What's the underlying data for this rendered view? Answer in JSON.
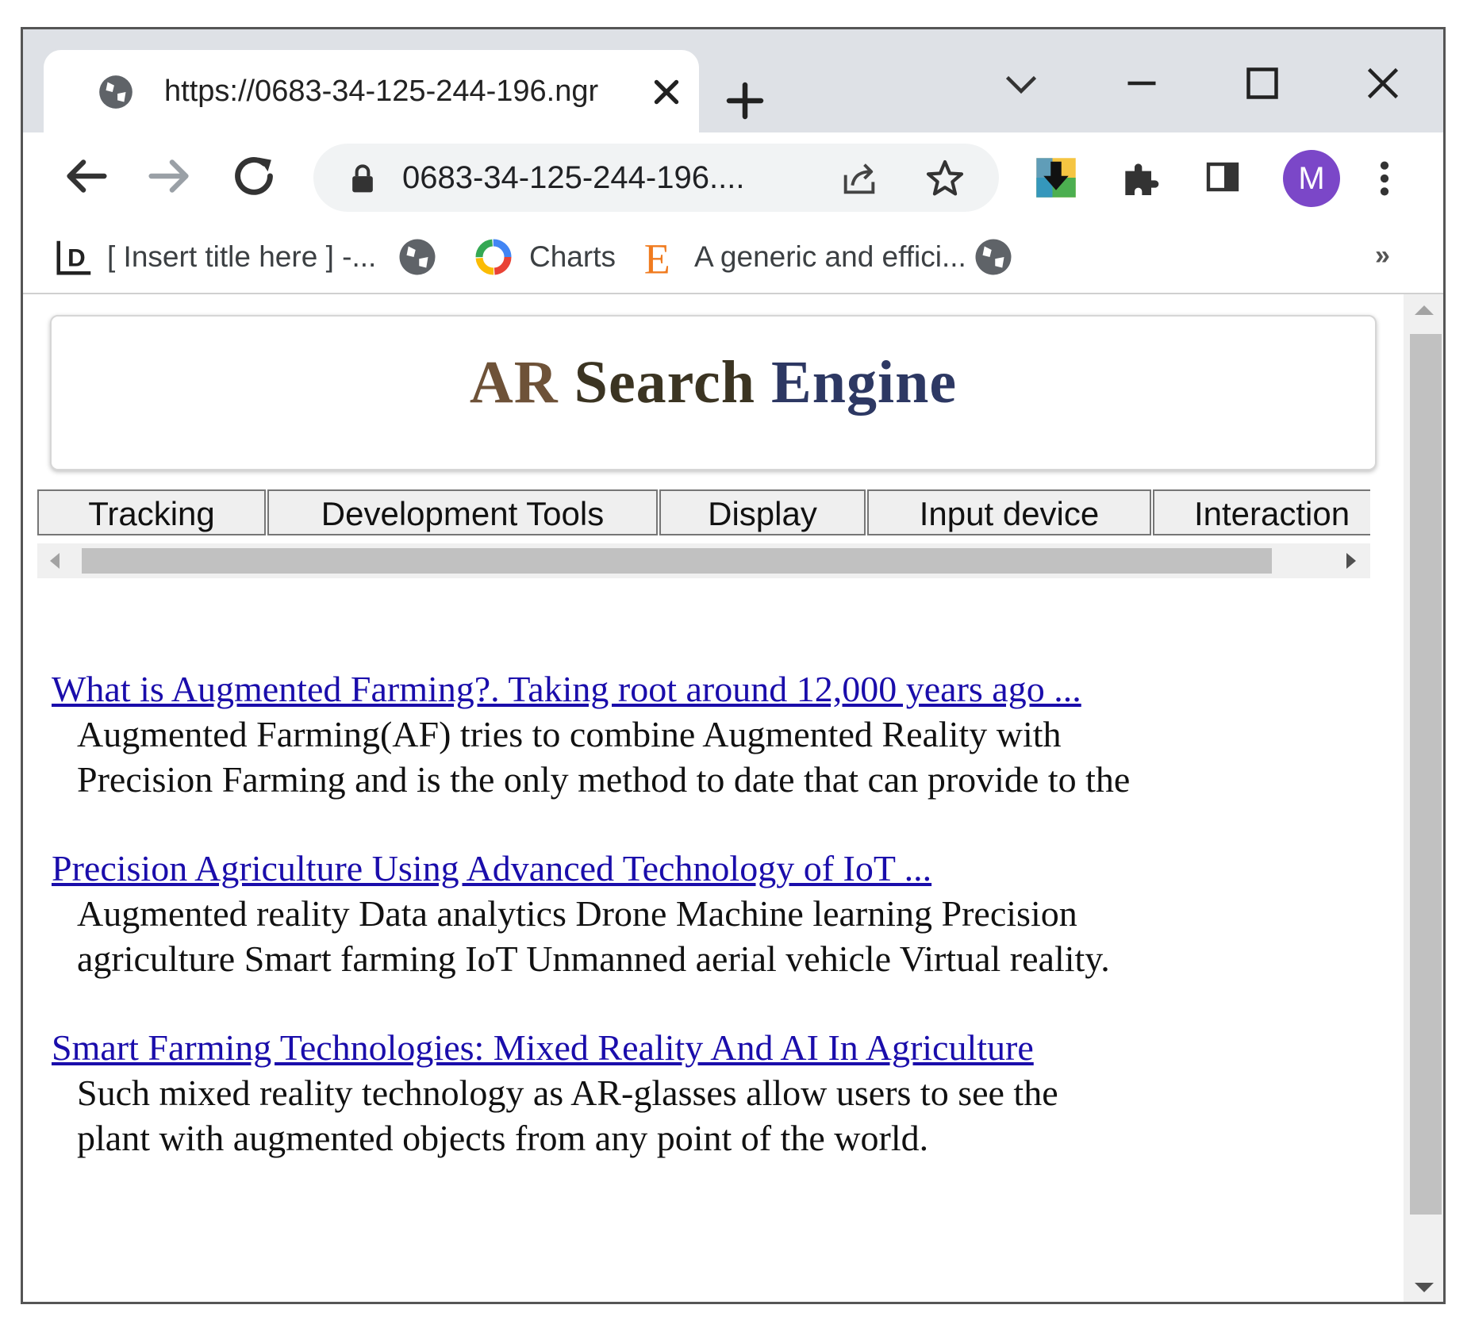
{
  "browser": {
    "tab_title": "https://0683-34-125-244-196.ngr",
    "address": "0683-34-125-244-196....",
    "profile_initial": "M",
    "bookmarks": [
      {
        "label": "[ Insert title here ] -...",
        "icon": "d-logo-icon"
      },
      {
        "label": "",
        "icon": "globe-icon"
      },
      {
        "label": "Charts",
        "icon": "charts-ring-icon"
      },
      {
        "label": "A generic and effici...",
        "icon": "e-logo-icon"
      },
      {
        "label": "",
        "icon": "globe-icon"
      }
    ],
    "bookmarks_overflow": "»",
    "accent_color": "#7b47c8"
  },
  "page": {
    "logo": {
      "ar": "AR",
      "search": "Search",
      "engine": "Engine"
    },
    "tabs": [
      {
        "label": "Tracking"
      },
      {
        "label": "Development Tools"
      },
      {
        "label": "Display"
      },
      {
        "label": "Input device"
      },
      {
        "label": "Interaction"
      }
    ],
    "results": [
      {
        "title": "What is Augmented Farming?. Taking root around 12,000 years ago ...",
        "snippet": "Augmented Farming(AF) tries to combine Augmented Reality with Precision Farming and is the only method to date that can provide to the"
      },
      {
        "title": "Precision Agriculture Using Advanced Technology of IoT ...",
        "snippet": "Augmented reality Data analytics Drone Machine learning Precision agriculture Smart farming IoT Unmanned aerial vehicle Virtual reality."
      },
      {
        "title": "Smart Farming Technologies: Mixed Reality And AI In Agriculture",
        "snippet": "Such mixed reality technology as AR-glasses allow users to see the plant with augmented objects from any point of the world."
      }
    ]
  }
}
